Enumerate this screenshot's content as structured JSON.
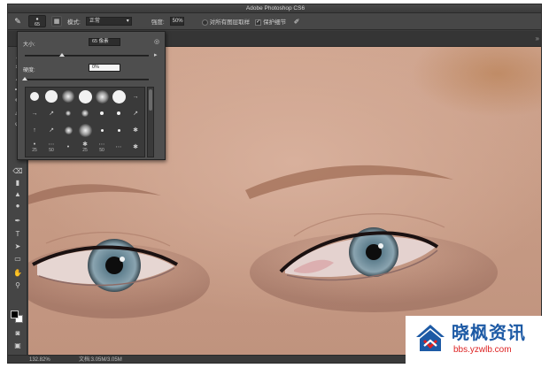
{
  "app": {
    "title": "Adobe Photoshop CS6"
  },
  "options_bar": {
    "tool_icon": "brush-tool-icon",
    "brush_size": "65",
    "mode_label": "模式:",
    "mode_value": "正常",
    "opacity_label": "强度:",
    "opacity_value": "50%",
    "sample_all_layers": "对所有图层取样",
    "protect_detail": "保护细节"
  },
  "brush_panel": {
    "size_label": "大小:",
    "size_value": "65 像素",
    "hardness_label": "硬度:",
    "hardness_value": "0%",
    "size_slider_level": 0.3,
    "hardness_slider_level": 0.0,
    "presets": [
      {
        "type": "hard",
        "size": 7
      },
      {
        "type": "hard",
        "size": 9
      },
      {
        "type": "soft",
        "size": 9
      },
      {
        "type": "hard",
        "size": 10
      },
      {
        "type": "soft",
        "size": 10
      },
      {
        "type": "hard",
        "size": 10
      },
      {
        "type": "glyph",
        "g": "→"
      },
      {
        "type": "glyph",
        "g": "→",
        "n": ""
      },
      {
        "type": "glyph",
        "g": "↗",
        "n": ""
      },
      {
        "type": "soft",
        "size": 4
      },
      {
        "type": "soft",
        "size": 5
      },
      {
        "type": "hard",
        "size": 3
      },
      {
        "type": "hard",
        "size": 3
      },
      {
        "type": "glyph",
        "g": "↗"
      },
      {
        "type": "glyph",
        "g": "↑"
      },
      {
        "type": "glyph",
        "g": "↗"
      },
      {
        "type": "soft",
        "size": 6
      },
      {
        "type": "soft",
        "size": 10
      },
      {
        "type": "hard",
        "size": 2
      },
      {
        "type": "hard",
        "size": 2
      },
      {
        "type": "glyph",
        "g": "✱"
      },
      {
        "type": "glyph",
        "g": "•",
        "n": "25"
      },
      {
        "type": "glyph",
        "g": "⋯",
        "n": "50"
      },
      {
        "type": "glyph",
        "g": "•"
      },
      {
        "type": "glyph",
        "g": "✱",
        "n": "25"
      },
      {
        "type": "glyph",
        "g": "⋯",
        "n": "50"
      },
      {
        "type": "glyph",
        "g": "⋯"
      },
      {
        "type": "glyph",
        "g": "✱"
      }
    ]
  },
  "toolbar": {
    "tools": [
      "lasso-icon",
      "crop-icon",
      "eyedropper-icon",
      "healing-icon",
      "brush-icon",
      "stamp-icon",
      "history-icon",
      "eraser-icon",
      "gradient-icon",
      "blur-icon",
      "dodge-icon",
      "pen-icon",
      "type-icon",
      "path-select-icon",
      "shape-icon",
      "hand-icon",
      "zoom-icon"
    ],
    "foreground_color": "#000000",
    "background_color": "#ffffff"
  },
  "status_bar": {
    "zoom": "132.82%",
    "doc_info": "文档:3.05M/3.05M"
  },
  "watermark": {
    "name": "晓枫资讯",
    "url": "bbs.yzwlb.com"
  }
}
